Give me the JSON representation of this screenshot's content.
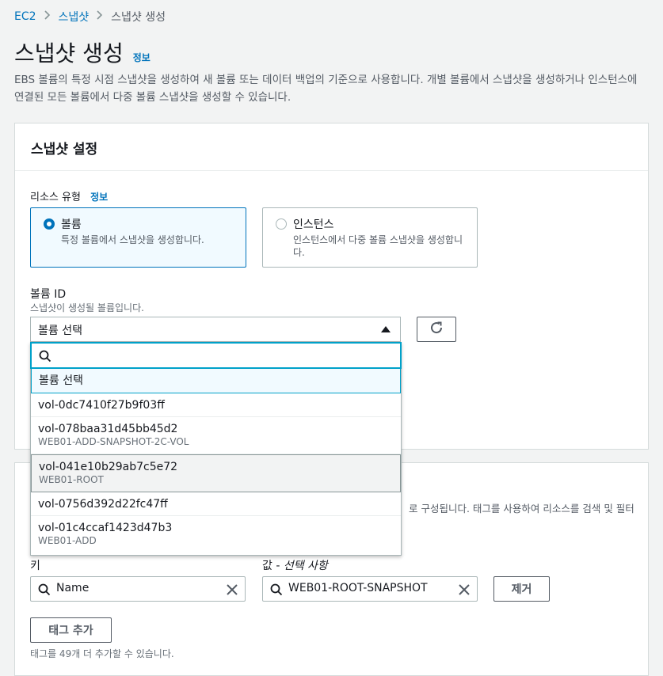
{
  "breadcrumb": {
    "root": "EC2",
    "parent": "스냅샷",
    "current": "스냅샷 생성"
  },
  "page": {
    "title": "스냅샷 생성",
    "info": "정보",
    "description": "EBS 볼륨의 특정 시점 스냅샷을 생성하여 새 볼륨 또는 데이터 백업의 기준으로 사용합니다. 개별 볼륨에서 스냅샷을 생성하거나 인스턴스에 연결된 모든 볼륨에서 다중 볼륨 스냅샷을 생성할 수 있습니다."
  },
  "settings": {
    "header": "스냅샷 설정",
    "resource_type_label": "리소스 유형",
    "resource_type_info": "정보",
    "options": [
      {
        "title": "볼륨",
        "desc": "특정 볼륨에서 스냅샷을 생성합니다.",
        "selected": true
      },
      {
        "title": "인스턴스",
        "desc": "인스턴스에서 다중 볼륨 스냅샷을 생성합니다.",
        "selected": false
      }
    ],
    "volume_id_label": "볼륨 ID",
    "volume_id_desc": "스냅샷이 생성될 볼륨입니다.",
    "select_value": "볼륨 선택"
  },
  "dropdown": {
    "search_value": "",
    "placeholder_option": "볼륨 선택",
    "items": [
      {
        "id": "vol-0dc7410f27b9f03ff",
        "name": ""
      },
      {
        "id": "vol-078baa31d45bb45d2",
        "name": "WEB01-ADD-SNAPSHOT-2C-VOL"
      },
      {
        "id": "vol-041e10b29ab7c5e72",
        "name": "WEB01-ROOT"
      },
      {
        "id": "vol-0756d392d22fc47ff",
        "name": ""
      },
      {
        "id": "vol-01c4ccaf1423d47b3",
        "name": "WEB01-ADD"
      }
    ]
  },
  "tags": {
    "desc_partial": "로 구성됩니다. 태그를 사용하여 리소스를 검색 및 필터",
    "key_label": "키",
    "value_label_prefix": "값 - ",
    "value_label_suffix": "선택 사항",
    "key_value": "Name",
    "value_value": "WEB01-ROOT-SNAPSHOT",
    "remove_label": "제거",
    "add_label": "태그 추가",
    "hint": "태그를 49개 더 추가할 수 있습니다."
  },
  "colors": {
    "link": "#0073bb",
    "focus": "#00a1c9"
  }
}
